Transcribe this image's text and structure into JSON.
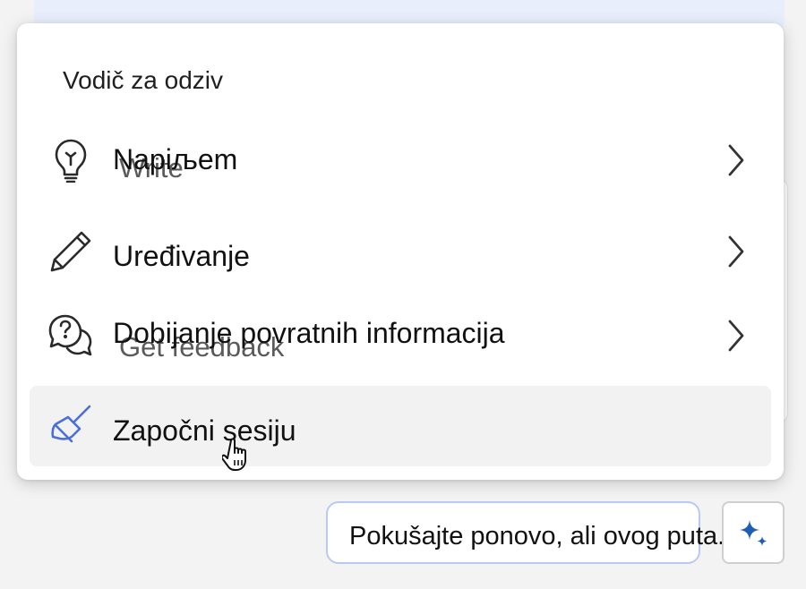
{
  "menu": {
    "title": "Vodič za odziv",
    "items": [
      {
        "label": "Napiљem",
        "icon": "lightbulb-icon",
        "ghost": "Write"
      },
      {
        "label": "Uređivanje",
        "icon": "pencil-icon"
      },
      {
        "label": "Dobijanje povratnih informacija",
        "icon": "chat-question-icon",
        "ghost": "Get feedback"
      },
      {
        "label": "Započni sesiju",
        "icon": "broom-icon"
      }
    ]
  },
  "suggestion": {
    "text": "Pokušajte ponovo, ali ovog puta..."
  },
  "colors": {
    "accent": "#4a6fd8",
    "suggestion_border": "#b9c9f3",
    "sparkle": "#1e5fb4"
  }
}
